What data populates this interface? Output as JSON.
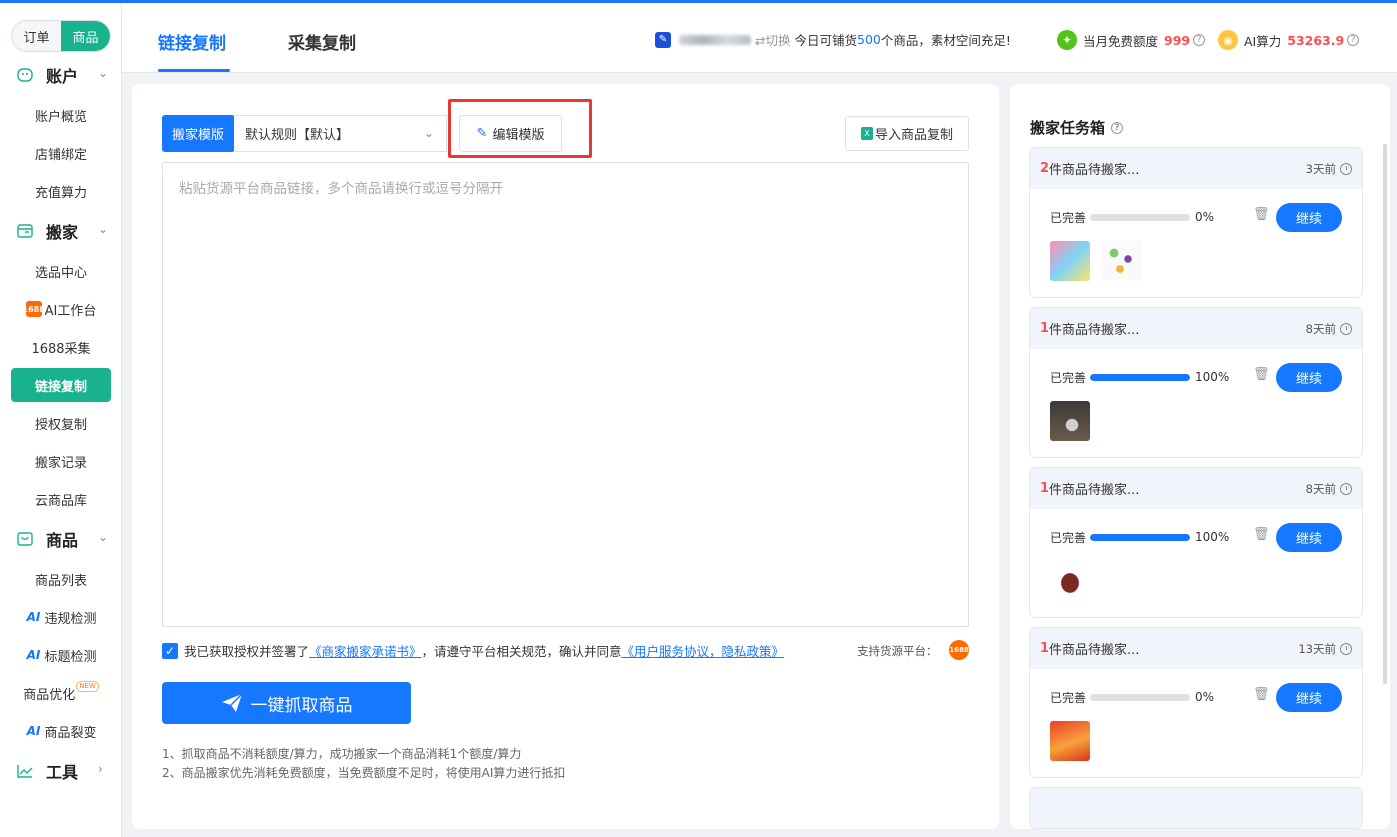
{
  "sidebar": {
    "segment": {
      "left": "订单",
      "right": "商品"
    },
    "groups": [
      {
        "label": "账户",
        "items": [
          "账户概览",
          "店铺绑定",
          "充值算力"
        ]
      },
      {
        "label": "搬家",
        "items": [
          "选品中心",
          "AI工作台",
          "1688采集",
          "链接复制",
          "授权复制",
          "搬家记录",
          "云商品库"
        ]
      },
      {
        "label": "商品",
        "items": [
          "商品列表",
          "违规检测",
          "标题检测",
          "商品优化",
          "商品裂变"
        ]
      },
      {
        "label": "工具",
        "items": []
      }
    ],
    "active_item": "链接复制",
    "ai_badge": "AI",
    "badge_1688": "1688",
    "new_tag": "NEW"
  },
  "header": {
    "tabs": [
      "链接复制",
      "采集复制"
    ],
    "switch_label": "切换",
    "info_prefix": "今日可铺货",
    "info_count": "500",
    "info_suffix": "个商品，素材空间充足!",
    "free_quota_label": "当月免费额度",
    "free_quota_value": "999",
    "ai_power_label": "AI算力",
    "ai_power_value": "53263.9"
  },
  "main": {
    "template_label": "搬家模版",
    "template_selected": "默认规则【默认】",
    "edit_template": "编辑模版",
    "import_button": "导入商品复制",
    "textarea_placeholder": "粘贴货源平台商品链接，多个商品请换行或逗号分隔开",
    "agree_text1": "我已获取授权并签署了",
    "agree_link1": "《商家搬家承诺书》",
    "agree_text2": "，请遵守平台相关规范，确认并同意",
    "agree_link2": "《用户服务协议，隐私政策》",
    "support_label": "支持货源平台：",
    "grab_button": "一键抓取商品",
    "notes": [
      "1、抓取商品不消耗额度/算力，成功搬家一个商品消耗1个额度/算力",
      "2、商品搬家优先消耗免费额度，当免费额度不足时，将使用AI算力进行抵扣"
    ]
  },
  "right_panel": {
    "title": "搬家任务箱",
    "progress_label": "已完善",
    "continue_label": "继续",
    "tasks": [
      {
        "count": "2",
        "title_suffix": "件商品待搬家...",
        "time": "3天前",
        "percent": "0%",
        "progress": 0
      },
      {
        "count": "1",
        "title_suffix": "件商品待搬家...",
        "time": "8天前",
        "percent": "100%",
        "progress": 1
      },
      {
        "count": "1",
        "title_suffix": "件商品待搬家...",
        "time": "8天前",
        "percent": "100%",
        "progress": 1
      },
      {
        "count": "1",
        "title_suffix": "件商品待搬家...",
        "time": "13天前",
        "percent": "0%",
        "progress": 0
      }
    ]
  },
  "colors": {
    "primary": "#1677ff",
    "sidebar_active": "#19b28f",
    "highlight_red": "#e53935",
    "count_red": "#ff4d4f"
  }
}
